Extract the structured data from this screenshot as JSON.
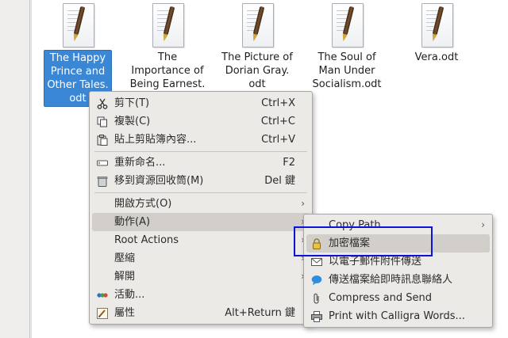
{
  "files": [
    {
      "label": "The Happy\nPrince and\nOther Tales.\nodt",
      "selected": true
    },
    {
      "label": "The\nImportance of\nBeing Earnest.",
      "selected": false
    },
    {
      "label": "The Picture of\nDorian Gray.\nodt",
      "selected": false
    },
    {
      "label": "The Soul of\nMan Under\nSocialism.odt",
      "selected": false
    },
    {
      "label": "Vera.odt",
      "selected": false
    }
  ],
  "context_menu": {
    "items": [
      {
        "label": "剪下(T)",
        "shortcut": "Ctrl+X",
        "icon": "scissors-icon"
      },
      {
        "label": "複製(C)",
        "shortcut": "Ctrl+C",
        "icon": "copy-icon"
      },
      {
        "label": "貼上剪貼簿內容...",
        "shortcut": "Ctrl+V",
        "icon": "paste-icon"
      },
      {
        "label": "重新命名...",
        "shortcut": "F2",
        "icon": "rename-icon"
      },
      {
        "label": "移到資源回收筒(M)",
        "shortcut": "Del 鍵",
        "icon": "trash-icon"
      },
      {
        "label": "開啟方式(O)",
        "submenu": true
      },
      {
        "label": "動作(A)",
        "submenu": true,
        "highlighted": true
      },
      {
        "label": "Root Actions",
        "submenu": true
      },
      {
        "label": "壓縮",
        "submenu": true
      },
      {
        "label": "解開",
        "submenu": true
      },
      {
        "label": "活動...",
        "icon": "activities-icon"
      },
      {
        "label": "屬性",
        "shortcut": "Alt+Return 鍵",
        "icon": "properties-icon"
      }
    ]
  },
  "action_submenu": {
    "items": [
      {
        "label": "Copy Path",
        "submenu": true
      },
      {
        "label": "加密檔案",
        "icon": "lock-icon",
        "highlighted": true
      },
      {
        "label": "以電子郵件附件傳送",
        "icon": "mail-icon"
      },
      {
        "label": "傳送檔案給即時訊息聯絡人",
        "icon": "chat-bubble-icon"
      },
      {
        "label": "Compress and Send",
        "icon": "paperclip-icon"
      },
      {
        "label": "Print with Calligra Words...",
        "icon": "printer-icon"
      }
    ]
  },
  "annotation": {
    "color": "#0b13d9"
  }
}
